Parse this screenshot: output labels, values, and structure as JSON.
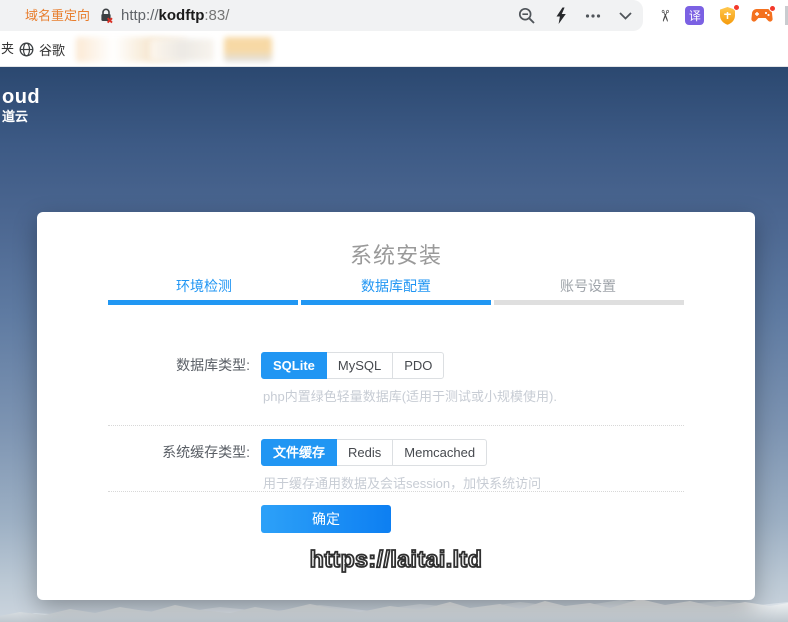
{
  "browser": {
    "tab_title": "域名重定向",
    "url": {
      "scheme": "http://",
      "host": "kodftp",
      "port": ":83/"
    },
    "icons": {
      "more_glyph": "…",
      "scissors_glyph": "✂",
      "translate_glyph": "译"
    }
  },
  "bookmarks_bar": {
    "cut_label": "夹",
    "google_label": "谷歌"
  },
  "background": {
    "logo_line1": "oud",
    "logo_line2": "道云"
  },
  "installer": {
    "title": "系统安装",
    "tabs": [
      {
        "label": "环境检测",
        "state": "done"
      },
      {
        "label": "数据库配置",
        "state": "active"
      },
      {
        "label": "账号设置",
        "state": "pending"
      }
    ],
    "db": {
      "label": "数据库类型:",
      "options": [
        "SQLite",
        "MySQL",
        "PDO"
      ],
      "selected": "SQLite",
      "desc": "php内置绿色轻量数据库(适用于测试或小规模使用)."
    },
    "cache": {
      "label": "系统缓存类型:",
      "options": [
        "文件缓存",
        "Redis",
        "Memcached"
      ],
      "selected": "文件缓存",
      "desc": "用于缓存通用数据及会话session，加快系统访问"
    },
    "submit_label": "确定",
    "watermark": "https://laitai.ltd"
  },
  "colors": {
    "accent_blue": "#2196f3",
    "submit_gradient_start": "#2da1f8",
    "submit_gradient_end": "#0d7ff2",
    "tab_orange": "#e87e2e",
    "badge_red": "#f3392b",
    "progress_empty": "#dfdfdf",
    "sky_top": "#2b4870",
    "sky_bottom": "#ccd5de"
  }
}
